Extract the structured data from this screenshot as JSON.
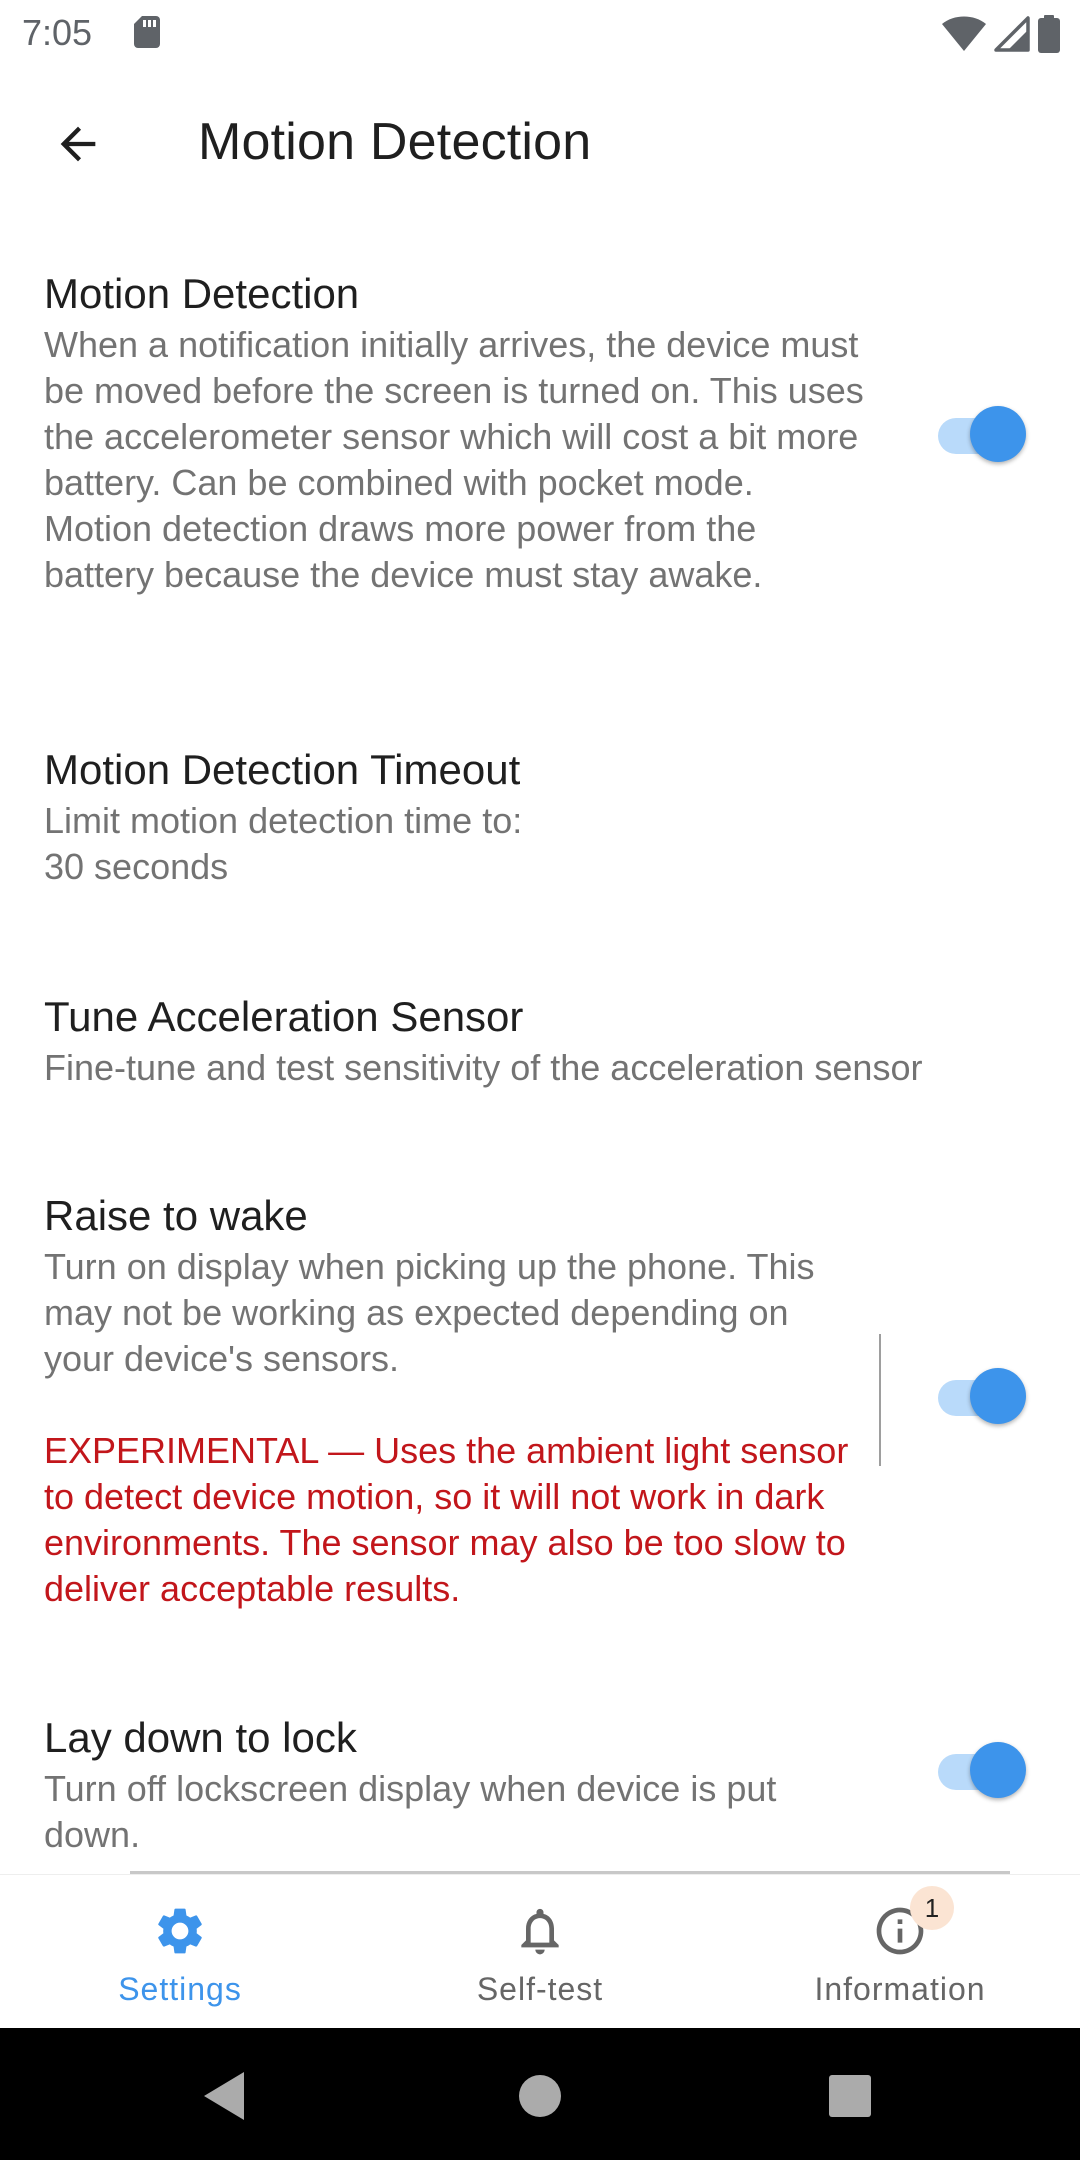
{
  "status_bar": {
    "time": "7:05"
  },
  "app_bar": {
    "title": "Motion Detection"
  },
  "preferences": [
    {
      "title": "Motion Detection",
      "summary": "When a notification initially arrives, the device must be moved before the screen is turned on. This uses the accelerometer sensor which will cost a bit more battery. Can be combined with pocket mode. Motion detection draws more power from the battery because the device must stay awake.",
      "switch_on": true
    },
    {
      "title": "Motion Detection Timeout",
      "summary": "Limit motion detection time to:\n30 seconds"
    },
    {
      "title": "Tune Acceleration Sensor",
      "summary": "Fine-tune and test sensitivity of the acceleration sensor"
    },
    {
      "title": "Raise to wake",
      "summary": "Turn on display when picking up the phone. This may not be working as expected depending on your device's sensors.",
      "warning": "EXPERIMENTAL — Uses the ambient light sensor to detect device motion, so it will not work in dark environments. The sensor may also be too slow to deliver acceptable results.",
      "switch_on": true
    },
    {
      "title": "Lay down to lock",
      "summary": "Turn off lockscreen display when device is put down.",
      "switch_on": true
    }
  ],
  "bottom_nav": {
    "items": [
      {
        "label": "Settings",
        "icon": "gear-icon",
        "active": true
      },
      {
        "label": "Self-test",
        "icon": "bell-icon",
        "active": false
      },
      {
        "label": "Information",
        "icon": "info-icon",
        "active": false,
        "badge": "1"
      }
    ]
  },
  "colors": {
    "accent": "#3d94eb",
    "switch_track": "#b9dafa",
    "warning": "#c2161b"
  }
}
